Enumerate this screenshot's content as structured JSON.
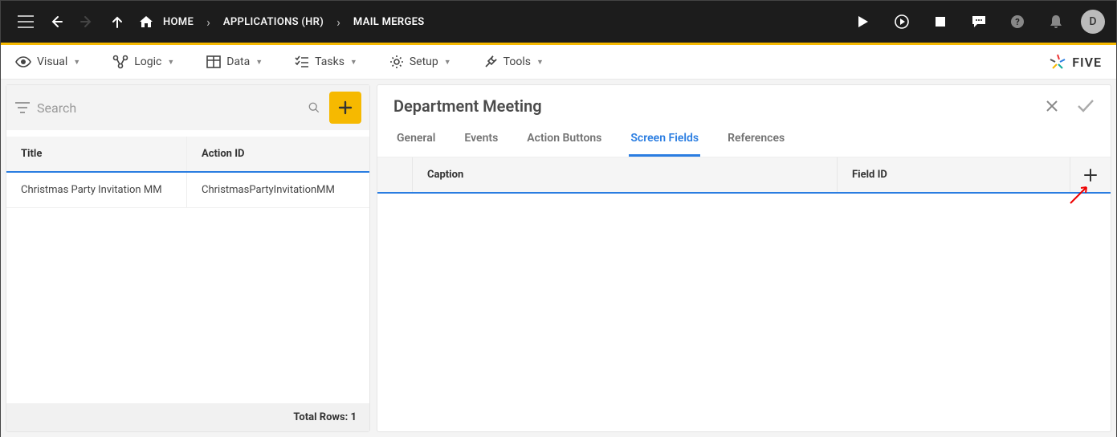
{
  "topbar": {
    "home_label": "HOME",
    "crumbs": [
      "APPLICATIONS (HR)",
      "MAIL MERGES"
    ],
    "avatar_initial": "D"
  },
  "menubar": {
    "items": [
      {
        "label": "Visual"
      },
      {
        "label": "Logic"
      },
      {
        "label": "Data"
      },
      {
        "label": "Tasks"
      },
      {
        "label": "Setup"
      },
      {
        "label": "Tools"
      }
    ],
    "brand": "FIVE"
  },
  "left_panel": {
    "search_placeholder": "Search",
    "columns": {
      "title": "Title",
      "action_id": "Action ID"
    },
    "rows": [
      {
        "title": "Christmas Party Invitation MM",
        "action_id": "ChristmasPartyInvitationMM"
      }
    ],
    "footer_label": "Total Rows: 1"
  },
  "right_panel": {
    "title": "Department Meeting",
    "tabs": [
      {
        "label": "General",
        "active": false
      },
      {
        "label": "Events",
        "active": false
      },
      {
        "label": "Action Buttons",
        "active": false
      },
      {
        "label": "Screen Fields",
        "active": true
      },
      {
        "label": "References",
        "active": false
      }
    ],
    "subgrid_columns": {
      "caption": "Caption",
      "field_id": "Field ID"
    }
  }
}
